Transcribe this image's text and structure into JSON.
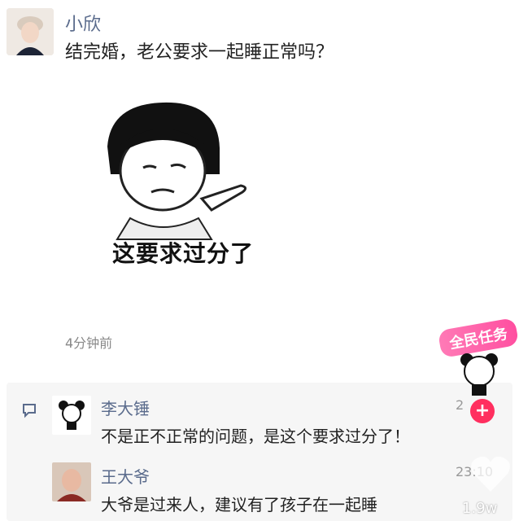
{
  "post": {
    "author": "小欣",
    "text": "结完婚，老公要求一起睡正常吗？",
    "meme_caption": "这要求过分了",
    "time": "4分钟前"
  },
  "comments": [
    {
      "name": "李大锤",
      "text": "不是正不正常的问题，是这个要求过分了！",
      "likes": "2"
    },
    {
      "name": "王大爷",
      "text": "大爷是过来人，建议有了孩子在一起睡",
      "likes": "23:10"
    }
  ],
  "overlay": {
    "badge_title": "全民任务",
    "plus": "+",
    "like_count": "1.9w"
  },
  "colors": {
    "name": "#5a6b8c",
    "accent": "#ff2f5f",
    "badge": "#ff4fa0"
  }
}
